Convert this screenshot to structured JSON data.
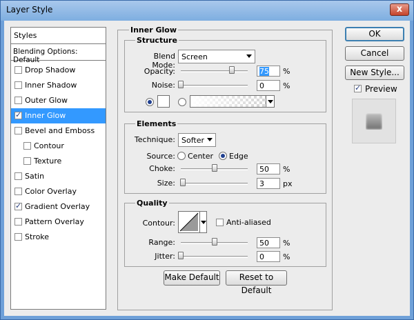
{
  "window": {
    "title": "Layer Style",
    "close_glyph": "x"
  },
  "styles_panel": {
    "header": "Styles",
    "blending": "Blending Options: Default",
    "items": [
      {
        "label": "Drop Shadow",
        "checked": false,
        "selected": false,
        "indent": false
      },
      {
        "label": "Inner Shadow",
        "checked": false,
        "selected": false,
        "indent": false
      },
      {
        "label": "Outer Glow",
        "checked": false,
        "selected": false,
        "indent": false
      },
      {
        "label": "Inner Glow",
        "checked": true,
        "selected": true,
        "indent": false
      },
      {
        "label": "Bevel and Emboss",
        "checked": false,
        "selected": false,
        "indent": false
      },
      {
        "label": "Contour",
        "checked": false,
        "selected": false,
        "indent": true
      },
      {
        "label": "Texture",
        "checked": false,
        "selected": false,
        "indent": true
      },
      {
        "label": "Satin",
        "checked": false,
        "selected": false,
        "indent": false
      },
      {
        "label": "Color Overlay",
        "checked": false,
        "selected": false,
        "indent": false
      },
      {
        "label": "Gradient Overlay",
        "checked": true,
        "selected": false,
        "indent": false
      },
      {
        "label": "Pattern Overlay",
        "checked": false,
        "selected": false,
        "indent": false
      },
      {
        "label": "Stroke",
        "checked": false,
        "selected": false,
        "indent": false
      }
    ]
  },
  "inner_glow": {
    "title": "Inner Glow",
    "structure": {
      "title": "Structure",
      "blend_mode_label": "Blend Mode:",
      "blend_mode": "Screen",
      "opacity_label": "Opacity:",
      "opacity": "75",
      "opacity_unit": "%",
      "opacity_level": 0.75,
      "noise_label": "Noise:",
      "noise": "0",
      "noise_unit": "%",
      "noise_level": 0
    },
    "elements": {
      "title": "Elements",
      "technique_label": "Technique:",
      "technique": "Softer",
      "source_label": "Source:",
      "source_center": "Center",
      "source_edge": "Edge",
      "source_selected": "edge",
      "choke_label": "Choke:",
      "choke": "50",
      "choke_unit": "%",
      "choke_level": 0.5,
      "size_label": "Size:",
      "size": "3",
      "size_unit": "px",
      "size_level": 0.02
    },
    "quality": {
      "title": "Quality",
      "contour_label": "Contour:",
      "antialiased_label": "Anti-aliased",
      "range_label": "Range:",
      "range": "50",
      "range_unit": "%",
      "range_level": 0.5,
      "jitter_label": "Jitter:",
      "jitter": "0",
      "jitter_unit": "%",
      "jitter_level": 0
    },
    "make_default": "Make Default",
    "reset_default": "Reset to Default"
  },
  "actions": {
    "ok": "OK",
    "cancel": "Cancel",
    "new_style": "New Style...",
    "preview_label": "Preview",
    "preview_checked": true
  }
}
